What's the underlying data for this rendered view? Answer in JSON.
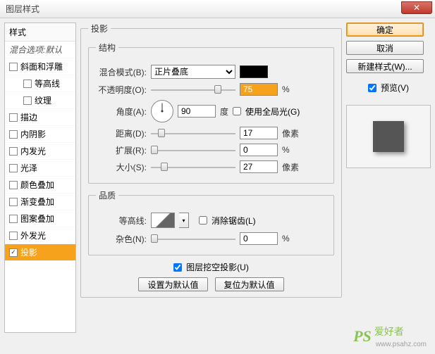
{
  "window": {
    "title": "图层样式"
  },
  "styles": {
    "header": "样式",
    "blend_default": "混合选项:默认",
    "items": [
      {
        "label": "斜面和浮雕",
        "checked": false,
        "indent": false
      },
      {
        "label": "等高线",
        "checked": false,
        "indent": true
      },
      {
        "label": "纹理",
        "checked": false,
        "indent": true
      },
      {
        "label": "描边",
        "checked": false,
        "indent": false
      },
      {
        "label": "内阴影",
        "checked": false,
        "indent": false
      },
      {
        "label": "内发光",
        "checked": false,
        "indent": false
      },
      {
        "label": "光泽",
        "checked": false,
        "indent": false
      },
      {
        "label": "颜色叠加",
        "checked": false,
        "indent": false
      },
      {
        "label": "渐变叠加",
        "checked": false,
        "indent": false
      },
      {
        "label": "图案叠加",
        "checked": false,
        "indent": false
      },
      {
        "label": "外发光",
        "checked": false,
        "indent": false
      },
      {
        "label": "投影",
        "checked": true,
        "indent": false,
        "selected": true
      }
    ]
  },
  "panel": {
    "group_title": "投影",
    "structure": {
      "legend": "结构",
      "blend_mode_label": "混合模式(B):",
      "blend_mode_value": "正片叠底",
      "swatch_color": "#000000",
      "opacity_label": "不透明度(O):",
      "opacity_value": "75",
      "opacity_unit": "%",
      "angle_label": "角度(A):",
      "angle_value": "90",
      "angle_unit": "度",
      "global_light_label": "使用全局光(G)",
      "global_light_checked": false,
      "distance_label": "距离(D):",
      "distance_value": "17",
      "distance_unit": "像素",
      "spread_label": "扩展(R):",
      "spread_value": "0",
      "spread_unit": "%",
      "size_label": "大小(S):",
      "size_value": "27",
      "size_unit": "像素"
    },
    "quality": {
      "legend": "品质",
      "contour_label": "等高线:",
      "antialias_label": "消除锯齿(L)",
      "antialias_checked": false,
      "noise_label": "杂色(N):",
      "noise_value": "0",
      "noise_unit": "%"
    },
    "knockout_label": "图层挖空投影(U)",
    "knockout_checked": true,
    "make_default": "设置为默认值",
    "reset_default": "复位为默认值"
  },
  "right": {
    "ok": "确定",
    "cancel": "取消",
    "new_style": "新建样式(W)...",
    "preview_label": "预览(V)",
    "preview_checked": true
  },
  "watermark": {
    "logo": "PS",
    "text": "爱好者",
    "sub": "www.psahz.com"
  }
}
